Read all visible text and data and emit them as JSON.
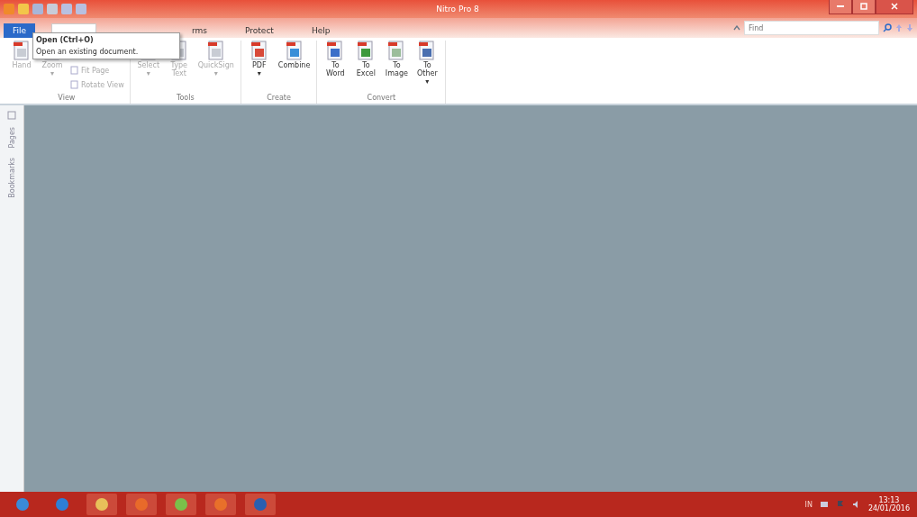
{
  "window": {
    "title": "Nitro Pro 8"
  },
  "tabs": [
    {
      "label": "File",
      "kind": "file"
    },
    {
      "kind": "tab",
      "selected": true
    },
    {
      "label": "rms",
      "kind": "tab",
      "selected": false
    },
    {
      "label": "Protect",
      "kind": "tab",
      "selected": false
    },
    {
      "label": "Help",
      "kind": "tab",
      "selected": false
    }
  ],
  "search": {
    "placeholder": "Find"
  },
  "tooltip": {
    "title": "Open (Ctrl+O)",
    "text": "Open an existing document."
  },
  "ribbon": [
    {
      "label": "View",
      "items": [
        {
          "kind": "large",
          "label": "Hand",
          "disabled": true
        },
        {
          "kind": "large",
          "label": "Zoom",
          "dropdown": "▾",
          "disabled": true
        },
        {
          "kind": "stack",
          "items": [
            {
              "label": "Fit Page",
              "disabled": true
            },
            {
              "label": "Rotate View",
              "disabled": true
            }
          ]
        }
      ]
    },
    {
      "label": "Tools",
      "items": [
        {
          "kind": "large",
          "label": "Select",
          "dropdown": "▾",
          "disabled": true
        },
        {
          "kind": "large",
          "label": "Type Text",
          "disabled": true
        },
        {
          "kind": "large",
          "label": "QuickSign",
          "dropdown": "▾",
          "disabled": true
        }
      ]
    },
    {
      "label": "Create",
      "items": [
        {
          "kind": "large",
          "label": "PDF",
          "dropdown": "▾",
          "disabled": false
        },
        {
          "kind": "large",
          "label": "Combine",
          "disabled": false
        }
      ]
    },
    {
      "label": "Convert",
      "items": [
        {
          "kind": "large",
          "label": "To Word",
          "disabled": false
        },
        {
          "kind": "large",
          "label": "To Excel",
          "disabled": false
        },
        {
          "kind": "large",
          "label": "To Image",
          "disabled": false
        },
        {
          "kind": "large",
          "label": "To Other",
          "dropdown": "▾",
          "disabled": false
        }
      ]
    }
  ],
  "side_tabs": [
    {
      "label": "Pages"
    },
    {
      "label": "Bookmarks"
    }
  ],
  "taskbar": {
    "language": "IN",
    "time": "13:13",
    "date": "24/01/2016"
  }
}
